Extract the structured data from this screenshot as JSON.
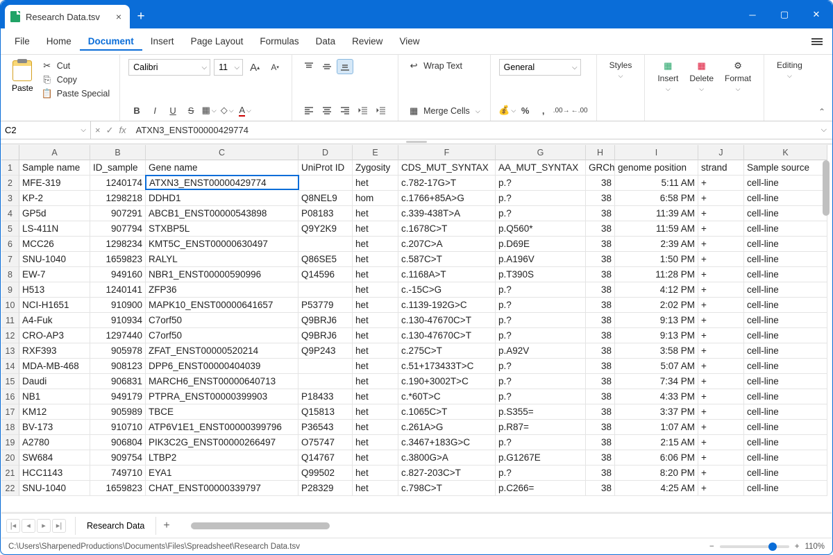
{
  "window": {
    "title": "Research Data.tsv"
  },
  "menu": {
    "items": [
      "File",
      "Home",
      "Document",
      "Insert",
      "Page Layout",
      "Formulas",
      "Data",
      "Review",
      "View"
    ],
    "active": "Document"
  },
  "ribbon": {
    "paste": "Paste",
    "cut": "Cut",
    "copy": "Copy",
    "paste_special": "Paste Special",
    "font_name": "Calibri",
    "font_size": "11",
    "wrap_text": "Wrap Text",
    "merge_cells": "Merge Cells",
    "number_format": "General",
    "styles": "Styles",
    "insert": "Insert",
    "delete": "Delete",
    "format": "Format",
    "editing": "Editing"
  },
  "formula_bar": {
    "cell_ref": "C2",
    "value": "ATXN3_ENST00000429774"
  },
  "columns": [
    "A",
    "B",
    "C",
    "D",
    "E",
    "F",
    "G",
    "H",
    "I",
    "J",
    "K"
  ],
  "headers": [
    "Sample name",
    "ID_sample",
    "Gene name",
    "UniProt ID",
    "Zygosity",
    "CDS_MUT_SYNTAX",
    "AA_MUT_SYNTAX",
    "GRCh",
    "genome position",
    "strand",
    "Sample source"
  ],
  "active_cell": {
    "row": 2,
    "col": 3
  },
  "rows": [
    [
      "MFE-319",
      "1240174",
      "ATXN3_ENST00000429774",
      "",
      "het",
      "c.782-17G>T",
      "p.?",
      "38",
      "5:11 AM",
      "+",
      "cell-line"
    ],
    [
      "KP-2",
      "1298218",
      "DDHD1",
      "Q8NEL9",
      "hom",
      "c.1766+85A>G",
      "p.?",
      "38",
      "6:58 PM",
      "+",
      "cell-line"
    ],
    [
      "GP5d",
      "907291",
      "ABCB1_ENST00000543898",
      "P08183",
      "het",
      "c.339-438T>A",
      "p.?",
      "38",
      "11:39 AM",
      "+",
      "cell-line"
    ],
    [
      "LS-411N",
      "907794",
      "STXBP5L",
      "Q9Y2K9",
      "het",
      "c.1678C>T",
      "p.Q560*",
      "38",
      "11:59 AM",
      "+",
      "cell-line"
    ],
    [
      "MCC26",
      "1298234",
      "KMT5C_ENST00000630497",
      "",
      "het",
      "c.207C>A",
      "p.D69E",
      "38",
      "2:39 AM",
      "+",
      "cell-line"
    ],
    [
      "SNU-1040",
      "1659823",
      "RALYL",
      "Q86SE5",
      "het",
      "c.587C>T",
      "p.A196V",
      "38",
      "1:50 PM",
      "+",
      "cell-line"
    ],
    [
      "EW-7",
      "949160",
      "NBR1_ENST00000590996",
      "Q14596",
      "het",
      "c.1168A>T",
      "p.T390S",
      "38",
      "11:28 PM",
      "+",
      "cell-line"
    ],
    [
      "H513",
      "1240141",
      "ZFP36",
      "",
      "het",
      "c.-15C>G",
      "p.?",
      "38",
      "4:12 PM",
      "+",
      "cell-line"
    ],
    [
      "NCI-H1651",
      "910900",
      "MAPK10_ENST00000641657",
      "P53779",
      "het",
      "c.1139-192G>C",
      "p.?",
      "38",
      "2:02 PM",
      "+",
      "cell-line"
    ],
    [
      "A4-Fuk",
      "910934",
      "C7orf50",
      "Q9BRJ6",
      "het",
      "c.130-47670C>T",
      "p.?",
      "38",
      "9:13 PM",
      "+",
      "cell-line"
    ],
    [
      "CRO-AP3",
      "1297440",
      "C7orf50",
      "Q9BRJ6",
      "het",
      "c.130-47670C>T",
      "p.?",
      "38",
      "9:13 PM",
      "+",
      "cell-line"
    ],
    [
      "RXF393",
      "905978",
      "ZFAT_ENST00000520214",
      "Q9P243",
      "het",
      "c.275C>T",
      "p.A92V",
      "38",
      "3:58 PM",
      "+",
      "cell-line"
    ],
    [
      "MDA-MB-468",
      "908123",
      "DPP6_ENST00000404039",
      "",
      "het",
      "c.51+173433T>C",
      "p.?",
      "38",
      "5:07 AM",
      "+",
      "cell-line"
    ],
    [
      "Daudi",
      "906831",
      "MARCH6_ENST00000640713",
      "",
      "het",
      "c.190+3002T>C",
      "p.?",
      "38",
      "7:34 PM",
      "+",
      "cell-line"
    ],
    [
      "NB1",
      "949179",
      "PTPRA_ENST00000399903",
      "P18433",
      "het",
      "c.*60T>C",
      "p.?",
      "38",
      "4:33 PM",
      "+",
      "cell-line"
    ],
    [
      "KM12",
      "905989",
      "TBCE",
      "Q15813",
      "het",
      "c.1065C>T",
      "p.S355=",
      "38",
      "3:37 PM",
      "+",
      "cell-line"
    ],
    [
      "BV-173",
      "910710",
      "ATP6V1E1_ENST00000399796",
      "P36543",
      "het",
      "c.261A>G",
      "p.R87=",
      "38",
      "1:07 AM",
      "+",
      "cell-line"
    ],
    [
      "A2780",
      "906804",
      "PIK3C2G_ENST00000266497",
      "O75747",
      "het",
      "c.3467+183G>C",
      "p.?",
      "38",
      "2:15 AM",
      "+",
      "cell-line"
    ],
    [
      "SW684",
      "909754",
      "LTBP2",
      "Q14767",
      "het",
      "c.3800G>A",
      "p.G1267E",
      "38",
      "6:06 PM",
      "+",
      "cell-line"
    ],
    [
      "HCC1143",
      "749710",
      "EYA1",
      "Q99502",
      "het",
      "c.827-203C>T",
      "p.?",
      "38",
      "8:20 PM",
      "+",
      "cell-line"
    ],
    [
      "SNU-1040",
      "1659823",
      "CHAT_ENST00000339797",
      "P28329",
      "het",
      "c.798C>T",
      "p.C266=",
      "38",
      "4:25 AM",
      "+",
      "cell-line"
    ]
  ],
  "sheet_tab": "Research Data",
  "status_path": "C:\\Users\\SharpenedProductions\\Documents\\Files\\Spreadsheet\\Research Data.tsv",
  "zoom_pct": "110%"
}
